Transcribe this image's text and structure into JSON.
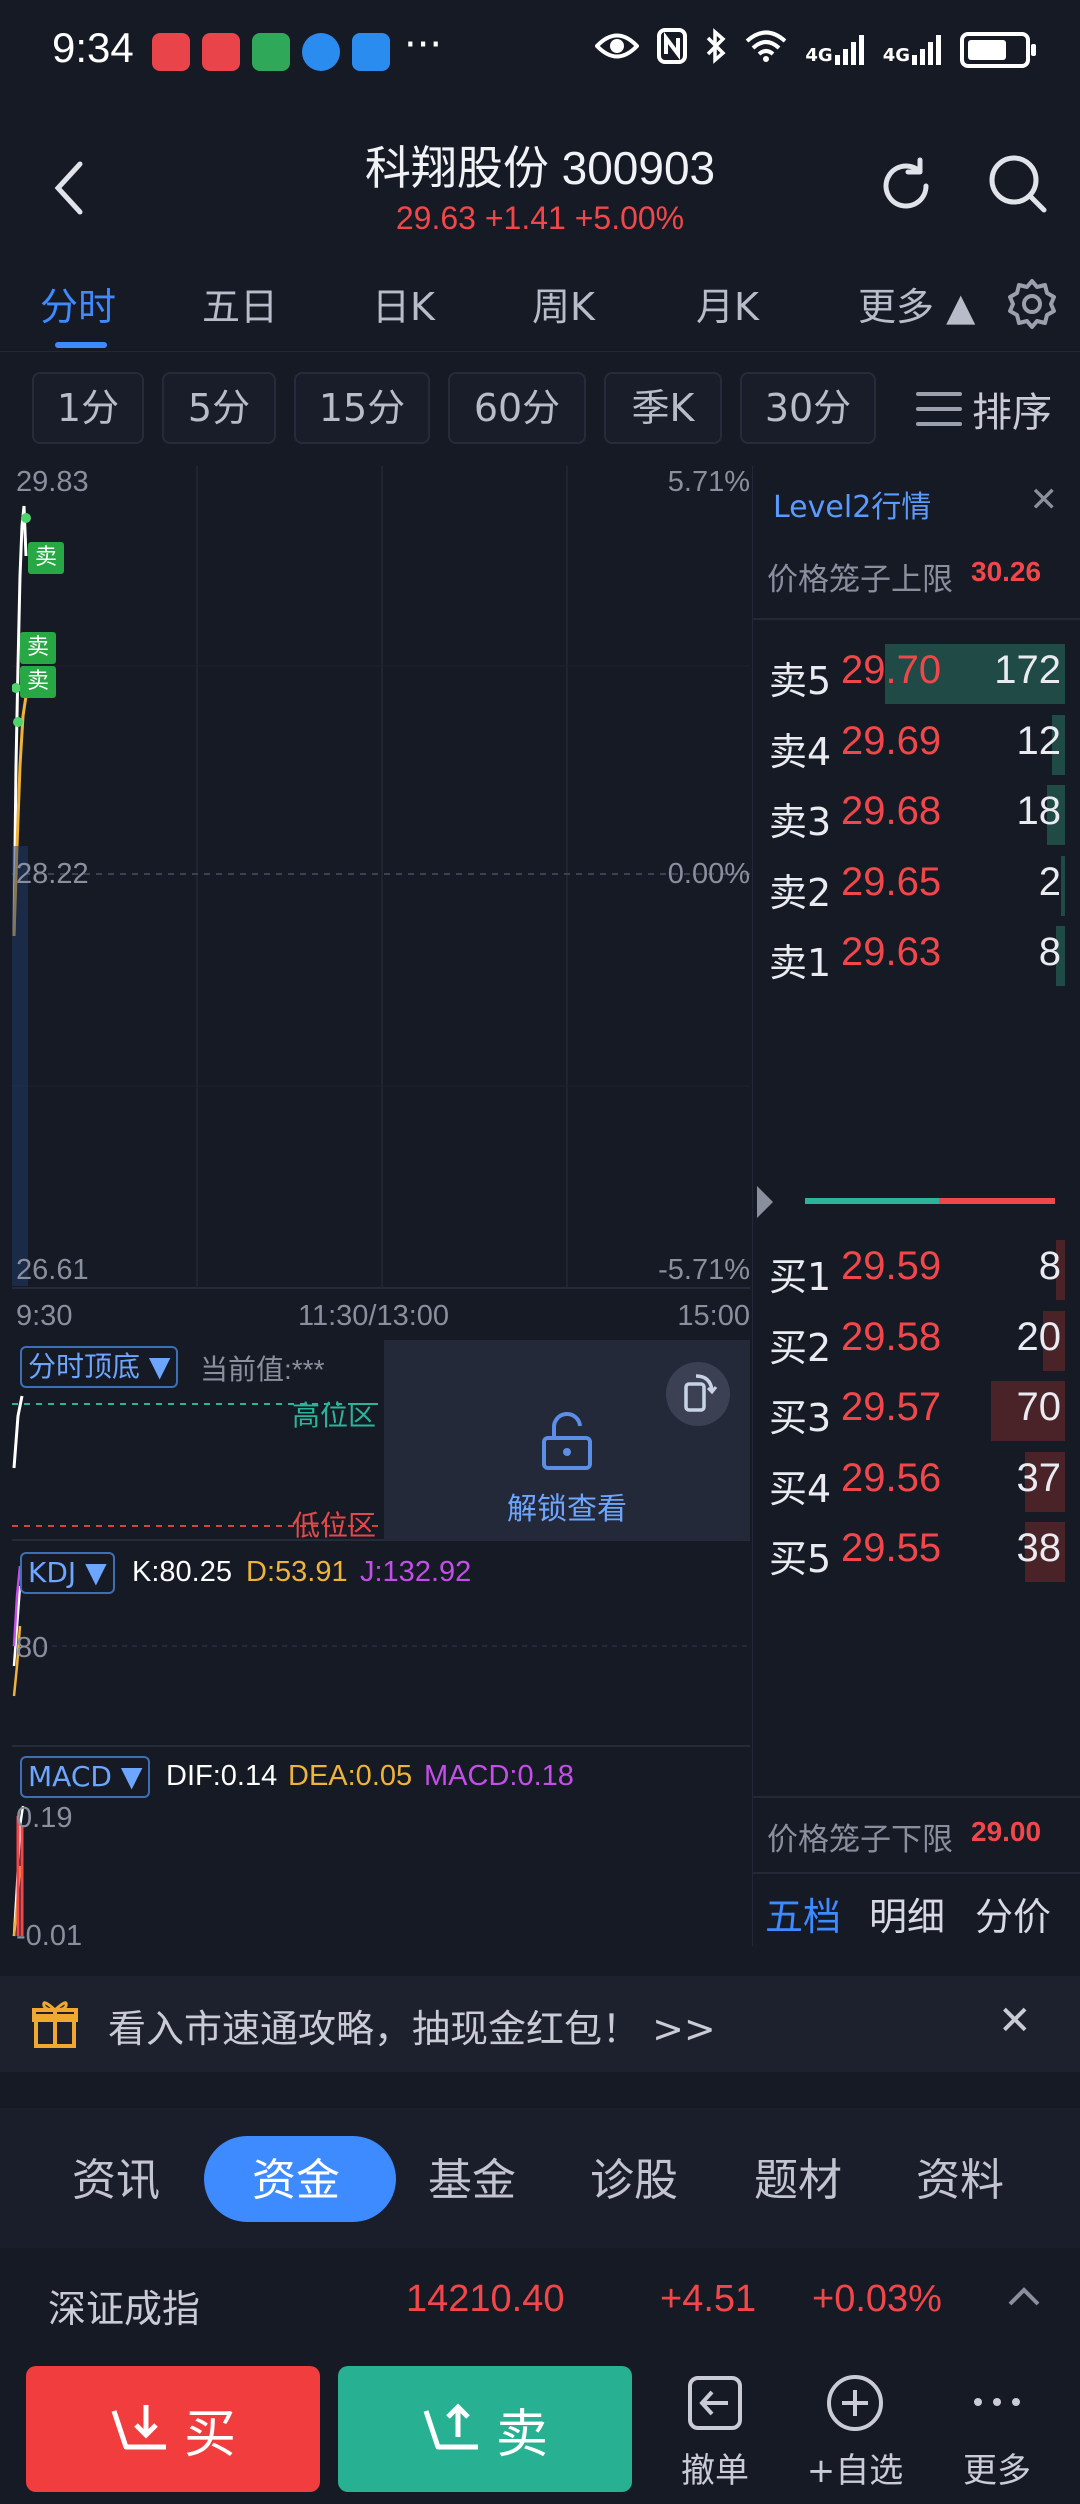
{
  "status_bar": {
    "time": "9:34",
    "more": "···",
    "net1": "4G",
    "net2": "4G"
  },
  "header": {
    "title": "科翔股份 300903",
    "quote": "29.63 +1.41 +5.00%"
  },
  "period_tabs": {
    "items": [
      "分时",
      "五日",
      "日K",
      "周K",
      "月K",
      "更多 ▲"
    ],
    "active": 0
  },
  "minute_tabs": {
    "items": [
      "1分",
      "5分",
      "15分",
      "60分",
      "季K",
      "30分"
    ],
    "sort": "排序"
  },
  "chart": {
    "price_high": "29.83",
    "price_mid": "28.22",
    "price_low": "26.61",
    "pct_high": "5.71%",
    "pct_mid": "0.00%",
    "pct_low": "-5.71%",
    "time_start": "9:30",
    "time_mid": "11:30/13:00",
    "time_end": "15:00",
    "sell_tag": "卖",
    "indicator": {
      "name": "分时顶底 ▼",
      "current": "当前值:***",
      "high_zone": "高位区",
      "low_zone": "低位区",
      "unlock": "解锁查看"
    },
    "kdj": {
      "name": "KDJ ▼",
      "k": "K:80.25",
      "d": "D:53.91",
      "j": "J:132.92",
      "level": "80"
    },
    "macd": {
      "name": "MACD ▼",
      "dif": "DIF:0.14",
      "dea": "DEA:0.05",
      "macd": "MACD:0.18",
      "top": "0.19",
      "bottom": "-0.01"
    }
  },
  "level2": {
    "title": "Level2行情",
    "upper_label": "价格笼子上限",
    "upper_value": "30.26",
    "lower_label": "价格笼子下限",
    "lower_value": "29.00",
    "asks": [
      {
        "side": "卖5",
        "price": "29.70",
        "vol": "172",
        "depth": 1.0
      },
      {
        "side": "卖4",
        "price": "29.69",
        "vol": "12",
        "depth": 0.07
      },
      {
        "side": "卖3",
        "price": "29.68",
        "vol": "18",
        "depth": 0.1
      },
      {
        "side": "卖2",
        "price": "29.65",
        "vol": "2",
        "depth": 0.01
      },
      {
        "side": "卖1",
        "price": "29.63",
        "vol": "8",
        "depth": 0.05
      }
    ],
    "bids": [
      {
        "side": "买1",
        "price": "29.59",
        "vol": "8",
        "depth": 0.05
      },
      {
        "side": "买2",
        "price": "29.58",
        "vol": "20",
        "depth": 0.12
      },
      {
        "side": "买3",
        "price": "29.57",
        "vol": "70",
        "depth": 0.41
      },
      {
        "side": "买4",
        "price": "29.56",
        "vol": "37",
        "depth": 0.22
      },
      {
        "side": "买5",
        "price": "29.55",
        "vol": "38",
        "depth": 0.22
      }
    ],
    "tabs": [
      "五档",
      "明细",
      "分价"
    ]
  },
  "promo": {
    "text": "看入市速通攻略，抽现金红包！ >>"
  },
  "content_tabs": {
    "items": [
      "资讯",
      "资金",
      "基金",
      "诊股",
      "题材",
      "资料"
    ],
    "active": 1
  },
  "index": {
    "name": "深证成指",
    "value": "14210.40",
    "change": "+4.51",
    "pct": "+0.03%"
  },
  "actions": {
    "buy": "买",
    "sell": "卖",
    "cancel": "撤单",
    "watch": "+自选",
    "more": "更多"
  },
  "colors": {
    "up": "#f2474a",
    "down": "#2bb49a",
    "accent": "#3d8bff",
    "bg": "#161a25"
  }
}
